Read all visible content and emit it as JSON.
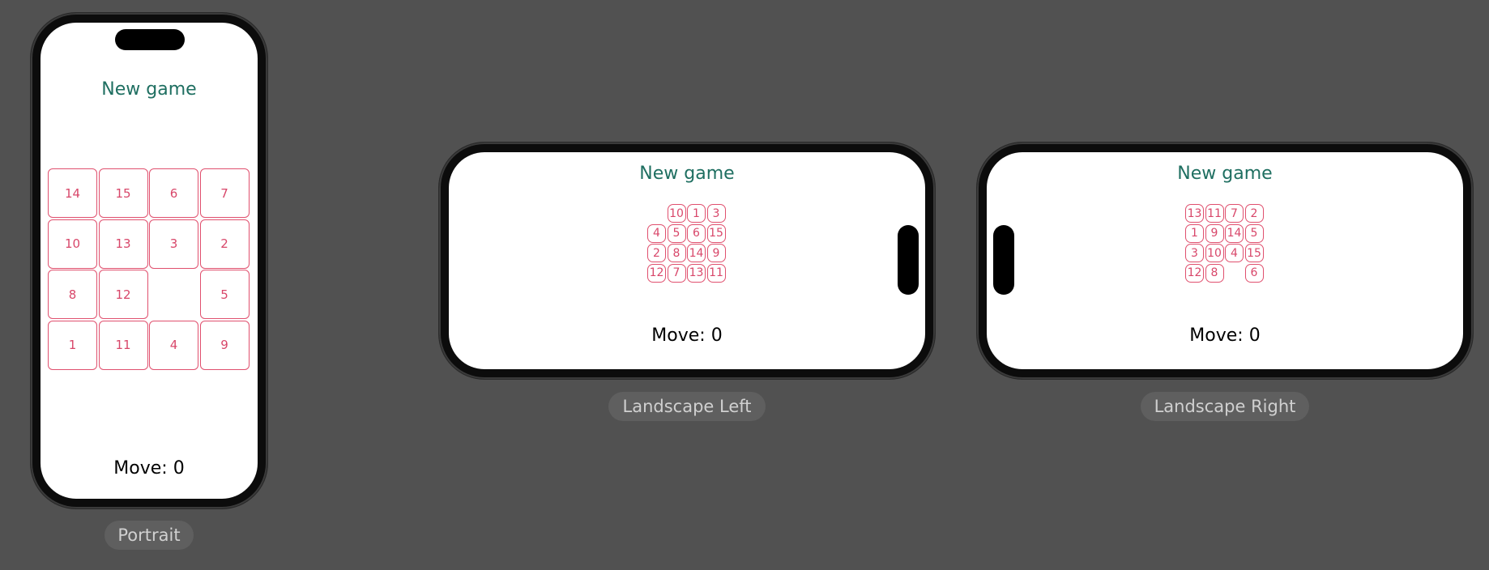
{
  "previews": [
    {
      "orientation_label": "Portrait",
      "new_game_label": "New game",
      "move_label": "Move: 0",
      "tiles": [
        "14",
        "15",
        "6",
        "7",
        "10",
        "13",
        "3",
        "2",
        "8",
        "12",
        "",
        "5",
        "1",
        "11",
        "4",
        "9"
      ]
    },
    {
      "orientation_label": "Landscape Left",
      "new_game_label": "New game",
      "move_label": "Move: 0",
      "tiles": [
        "",
        "10",
        "1",
        "3",
        "4",
        "5",
        "6",
        "15",
        "2",
        "8",
        "14",
        "9",
        "12",
        "7",
        "13",
        "11"
      ]
    },
    {
      "orientation_label": "Landscape Right",
      "new_game_label": "New game",
      "move_label": "Move: 0",
      "tiles": [
        "13",
        "11",
        "7",
        "2",
        "1",
        "9",
        "14",
        "5",
        "3",
        "10",
        "4",
        "15",
        "12",
        "8",
        "",
        "6"
      ]
    }
  ],
  "colors": {
    "background": "#515151",
    "accent": "#1f6f61",
    "tile_border": "#e0506e",
    "tile_text": "#d8476a"
  }
}
